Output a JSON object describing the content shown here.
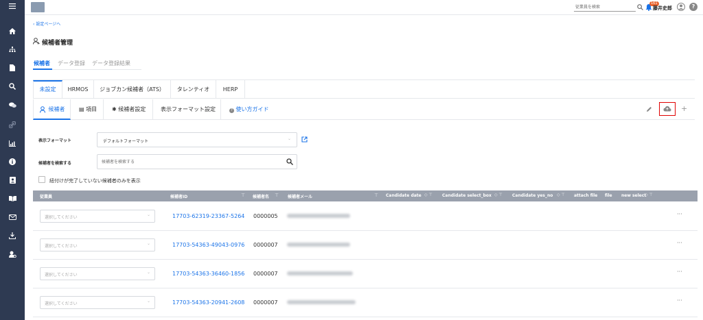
{
  "header": {
    "search_placeholder": "従業員を検索",
    "notification_count": "161",
    "user_name": "藤井史郎",
    "help": "?"
  },
  "back_link": "設定ページへ",
  "page_title": "候補者管理",
  "main_tabs": [
    "候補者",
    "データ登録",
    "データ登録結果"
  ],
  "integration_tabs": [
    "未設定",
    "HRMOS",
    "ジョブカン候補者（ATS）",
    "タレンティオ",
    "HERP"
  ],
  "sub_tabs": [
    "候補者",
    "項目",
    "候補者設定",
    "表示フォーマット設定"
  ],
  "guide_link": "使い方ガイド",
  "form": {
    "format_label": "表示フォーマット",
    "format_value": "デフォルトフォーマット",
    "search_label": "候補者を検索する",
    "search_placeholder": "候補者を検索する",
    "checkbox_label": "紐付けが完了していない候補者のみを表示"
  },
  "table": {
    "headers": [
      "従業員",
      "候補者ID",
      "候補者名",
      "候補者メール",
      "Candidate date",
      "Candidate select_box",
      "Candidate yes_no",
      "attach file",
      "file",
      "new select"
    ],
    "rows": [
      {
        "employee": "選択してください",
        "id": "17703-62319-23367-5264",
        "name": "0000005",
        "more": "···"
      },
      {
        "employee": "選択してください",
        "id": "17703-54363-49043-0976",
        "name": "0000007",
        "more": "···"
      },
      {
        "employee": "選択してください",
        "id": "17703-54363-36460-1856",
        "name": "0000007",
        "more": "···"
      },
      {
        "employee": "選択してください",
        "id": "17703-54363-20941-2608",
        "name": "0000007",
        "more": "···"
      }
    ]
  },
  "icons": [
    "menu-icon",
    "home-icon",
    "org-chart-icon",
    "document-icon",
    "search-icon",
    "chat-icon",
    "link-icon",
    "chart-icon",
    "info-icon",
    "contact-icon",
    "book-icon",
    "mail-icon",
    "download-icon",
    "user-settings-icon"
  ],
  "colors": {
    "sidebar": "#2e3a52",
    "accent": "#1a73e8",
    "table_header": "#9aa1ad",
    "highlight": "#e00000",
    "badge": "#e8632d"
  }
}
